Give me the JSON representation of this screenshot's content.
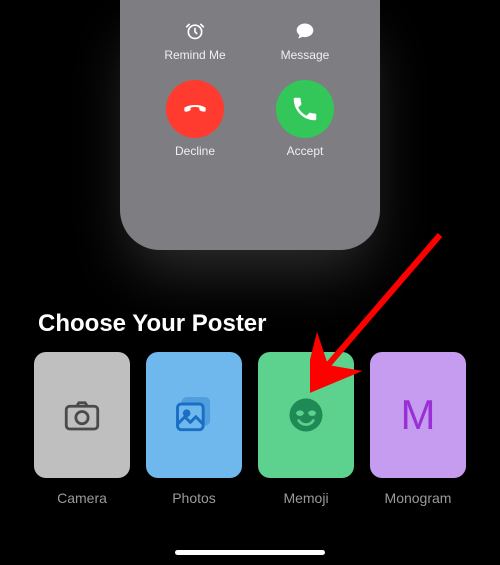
{
  "call_preview": {
    "remind": {
      "label": "Remind Me",
      "icon": "alarm-icon"
    },
    "message": {
      "label": "Message",
      "icon": "message-icon"
    },
    "decline": {
      "label": "Decline",
      "icon": "phone-down-icon",
      "color": "#ff3b30"
    },
    "accept": {
      "label": "Accept",
      "icon": "phone-icon",
      "color": "#33c759"
    }
  },
  "section_title": "Choose Your Poster",
  "poster_options": {
    "camera": {
      "label": "Camera",
      "icon": "camera-icon",
      "bg": "#bfbfbf"
    },
    "photos": {
      "label": "Photos",
      "icon": "photos-icon",
      "bg": "#6fb8ee"
    },
    "memoji": {
      "label": "Memoji",
      "icon": "memoji-icon",
      "bg": "#5dd28e"
    },
    "monogram": {
      "label": "Monogram",
      "letter": "M",
      "bg": "#c59cf0"
    }
  },
  "annotation": {
    "type": "arrow",
    "target": "memoji",
    "color": "#ff0000"
  }
}
